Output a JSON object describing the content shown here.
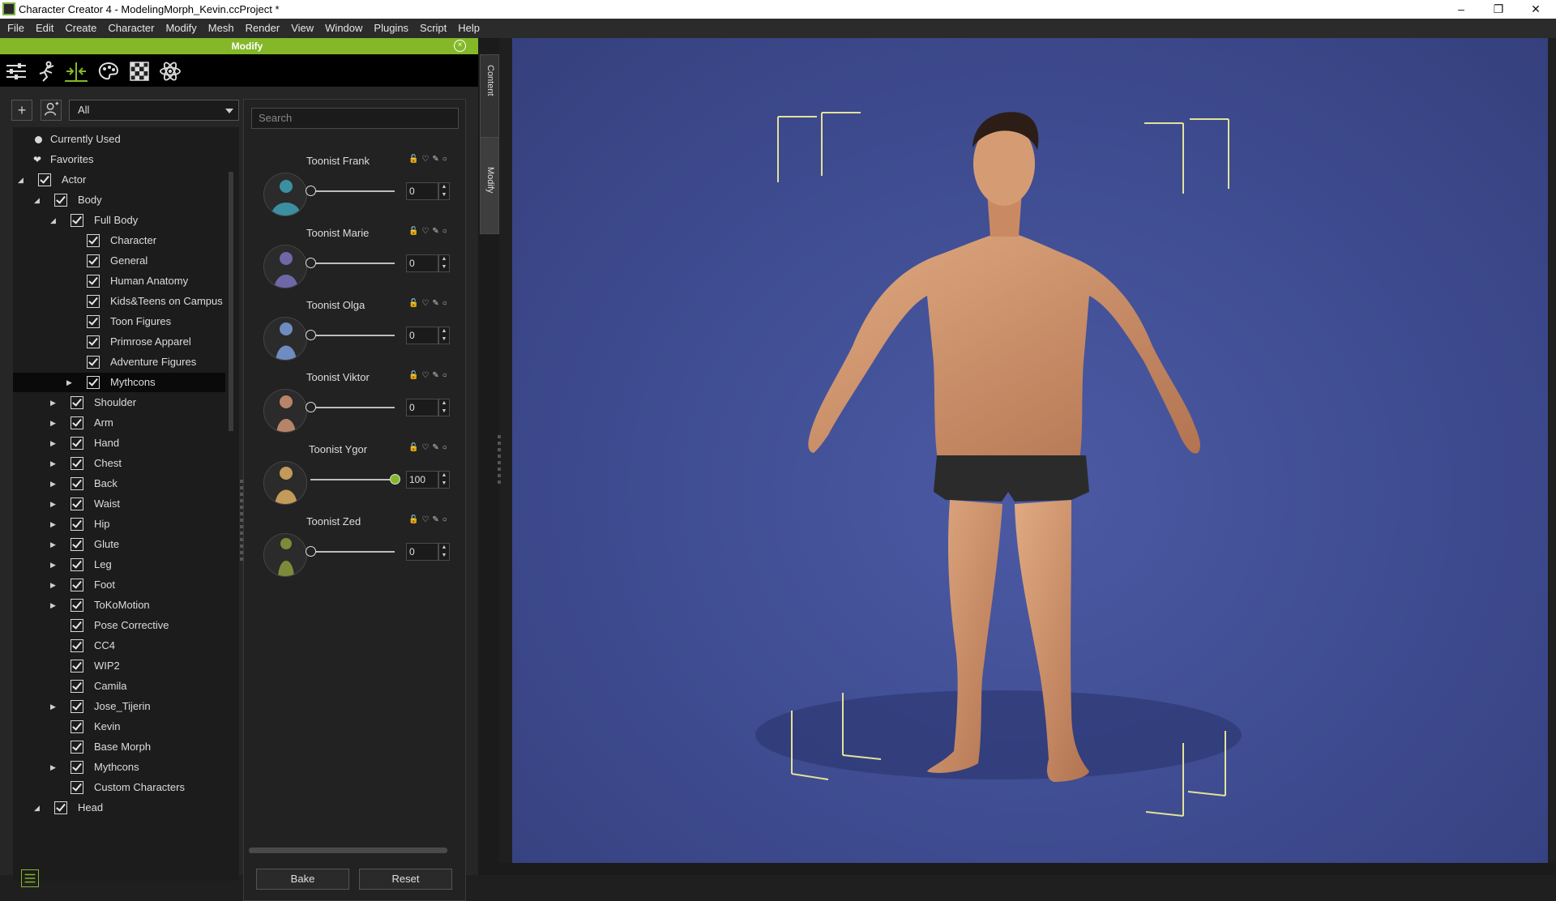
{
  "window": {
    "title": "Character Creator 4 - ModelingMorph_Kevin.ccProject *",
    "controls": [
      "–",
      "❐",
      "✕"
    ]
  },
  "menu": [
    "File",
    "Edit",
    "Create",
    "Character",
    "Modify",
    "Mesh",
    "Render",
    "View",
    "Window",
    "Plugins",
    "Script",
    "Help"
  ],
  "panel": {
    "title": "Modify",
    "tools": [
      "sliders-icon",
      "pose-icon",
      "morph-icon",
      "palette-icon",
      "checker-icon",
      "atom-icon"
    ]
  },
  "filter": {
    "selected": "All"
  },
  "tree": {
    "currently_used": "Currently Used",
    "favorites": "Favorites",
    "actor": "Actor",
    "body": "Body",
    "full_body": "Full Body",
    "full_body_items": [
      "Character",
      "General",
      "Human Anatomy",
      "Kids&Teens on Campus",
      "Toon Figures",
      "Primrose Apparel",
      "Adventure Figures",
      "Mythcons"
    ],
    "body_items": [
      "Shoulder",
      "Arm",
      "Hand",
      "Chest",
      "Back",
      "Waist",
      "Hip",
      "Glute",
      "Leg",
      "Foot",
      "ToKoMotion",
      "Pose Corrective",
      "CC4",
      "WIP2",
      "Camila",
      "Jose_Tijerin",
      "Kevin",
      "Base Morph",
      "Mythcons",
      "Custom Characters"
    ],
    "head": "Head"
  },
  "search": {
    "placeholder": "Search"
  },
  "morphs": [
    {
      "name": "Toonist Frank",
      "value": "0",
      "level": 0,
      "color": "#3c8fa0"
    },
    {
      "name": "Toonist Marie",
      "value": "0",
      "level": 0,
      "color": "#6e68a8"
    },
    {
      "name": "Toonist Olga",
      "value": "0",
      "level": 0,
      "color": "#6f8cc0"
    },
    {
      "name": "Toonist Viktor",
      "value": "0",
      "level": 0,
      "color": "#b7846a"
    },
    {
      "name": "Toonist Ygor",
      "value": "100",
      "level": 1,
      "color": "#c49a5a"
    },
    {
      "name": "Toonist Zed",
      "value": "0",
      "level": 0,
      "color": "#7e8a3a"
    }
  ],
  "morph_icons": "🔓♡✎○",
  "buttons": {
    "bake": "Bake",
    "reset": "Reset"
  },
  "side_tabs": {
    "content": "Content",
    "modify": "Modify"
  },
  "colors": {
    "accent": "#84b829",
    "viewport": "#3d4a8e"
  }
}
